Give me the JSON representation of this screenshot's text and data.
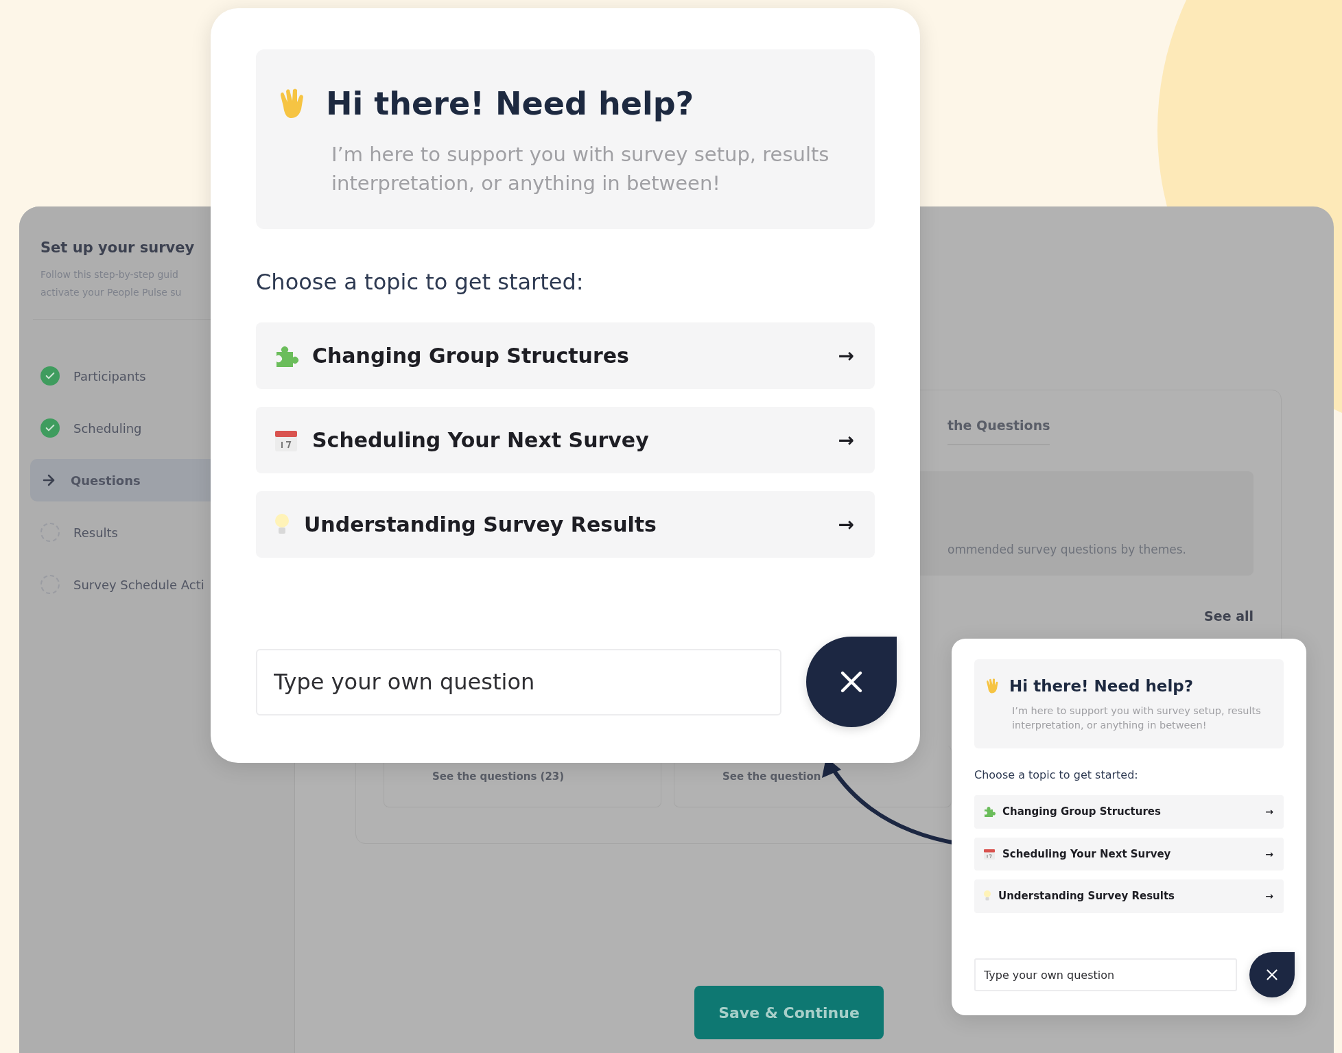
{
  "app": {
    "sidebar": {
      "title": "Set up your survey",
      "subtitle_lines": [
        "Follow this step-by-step guid",
        "activate your People Pulse su"
      ],
      "steps": [
        {
          "label": "Participants",
          "kind": "done",
          "selected": false
        },
        {
          "label": "Scheduling",
          "kind": "done",
          "selected": false
        },
        {
          "label": "Questions",
          "kind": "current",
          "selected": true
        },
        {
          "label": "Results",
          "kind": "pending",
          "selected": false
        },
        {
          "label": "Survey Schedule Acti",
          "kind": "pending",
          "selected": false
        }
      ]
    },
    "content": {
      "tab": "the Questions",
      "banner_text": "ommended survey questions by themes.",
      "see_all": "See all",
      "cards": [
        {
          "link": "See the questions (23)"
        },
        {
          "link": "See the question"
        }
      ],
      "save_button": "Save & Continue"
    }
  },
  "help_panels": [
    {
      "title": "Hi there! Need help?",
      "intro": "I’m here to support you with survey setup, results interpretation, or anything in between!",
      "prompt": "Choose a topic to get started:",
      "topics": [
        {
          "kind": "puzzle",
          "label": "Changing Group Structures",
          "arrow": "→"
        },
        {
          "kind": "calendar",
          "label": "Scheduling Your Next Survey",
          "arrow": "→"
        },
        {
          "kind": "bulb",
          "label": "Understanding Survey Results",
          "arrow": "→"
        }
      ],
      "placeholder": "Type your own question"
    },
    {
      "title": "Hi there! Need help?",
      "intro": "I’m here to support you with survey setup, results interpretation, or anything in between!",
      "prompt": "Choose a topic to get started:",
      "topics": [
        {
          "kind": "puzzle",
          "label": "Changing Group Structures",
          "arrow": "→"
        },
        {
          "kind": "calendar",
          "label": "Scheduling Your Next Survey",
          "arrow": "→"
        },
        {
          "kind": "bulb",
          "label": "Understanding Survey Results",
          "arrow": "→"
        }
      ],
      "placeholder": "Type your own question"
    }
  ]
}
